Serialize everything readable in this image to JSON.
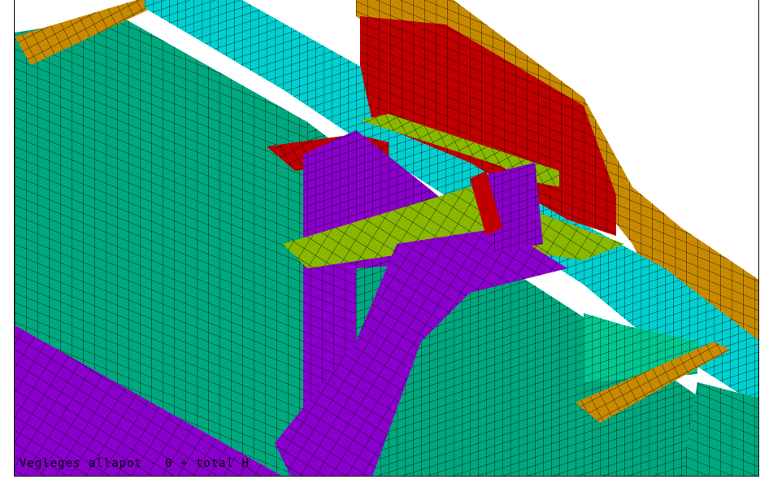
{
  "viewport": {
    "status_text": "Vegleges allapot - 0 + total H"
  },
  "colors": {
    "background": "#ffffff",
    "mesh_line": "#000000",
    "green_structure": "#00a87e",
    "purple_structure": "#8a00cc",
    "cyan_structure": "#00d0d0",
    "orange_structure": "#c88a00",
    "red_structure": "#c00000",
    "yellowgreen_structure": "#88b800",
    "light_green_structure": "#00c890"
  },
  "model": {
    "type": "finite-element mesh",
    "parts": [
      "left-green-wall",
      "rear-cyan-beam",
      "top-orange-flange",
      "red-bulkhead",
      "yellowgreen-deck",
      "purple-web",
      "purple-bracket",
      "right-orange-beam",
      "lower-left-purple-plate"
    ]
  }
}
